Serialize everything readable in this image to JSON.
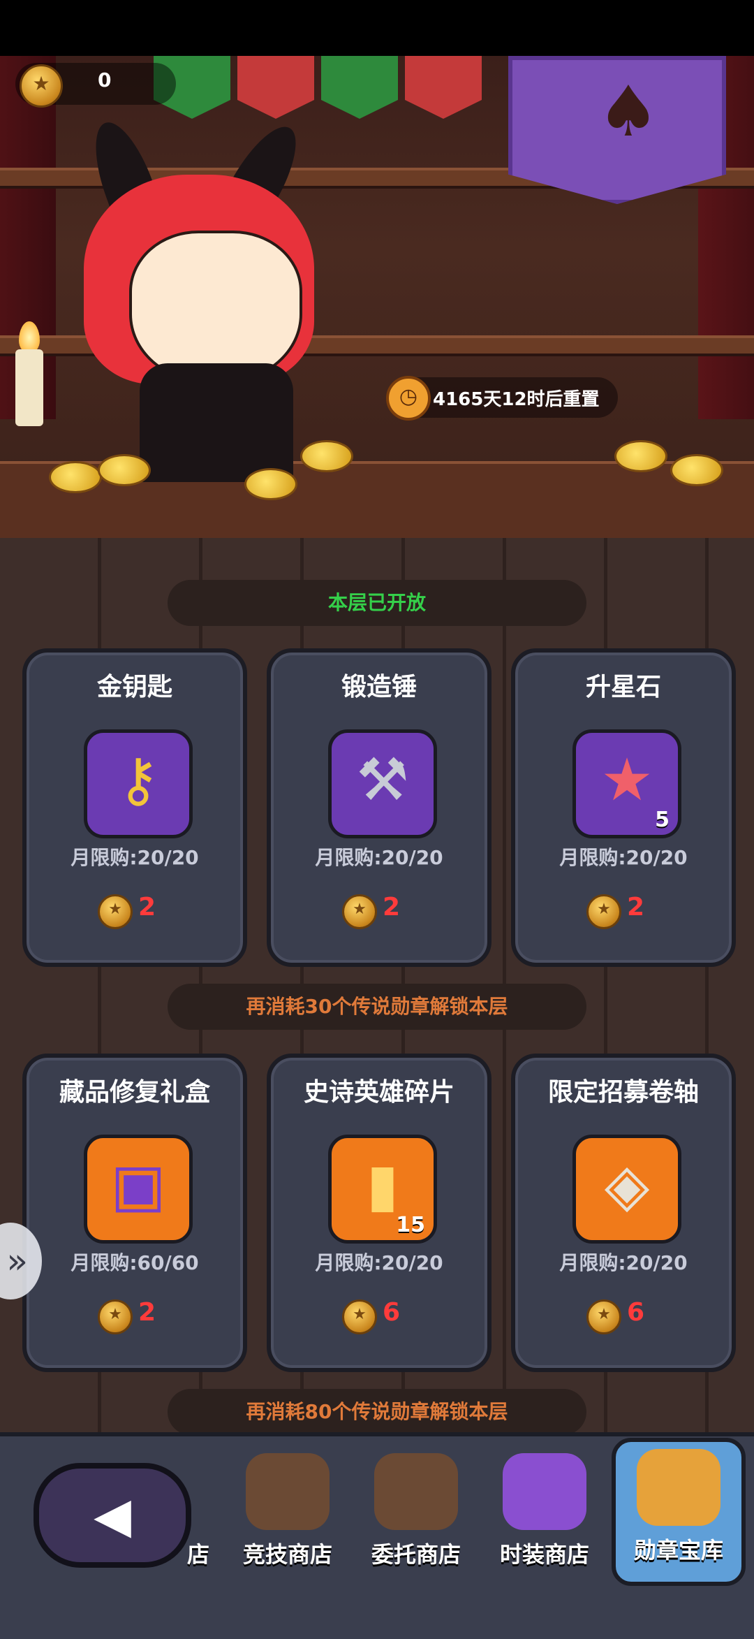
{
  "header": {
    "medal_count": "0",
    "reset_timer": "4165天12时后重置"
  },
  "sections": [
    {
      "status": "本层已开放",
      "status_color": "#35d04a",
      "items": [
        {
          "name": "金钥匙",
          "icon": "golden-key-icon",
          "bg": "purple",
          "glyph": "🔑",
          "qty": "",
          "limit": "月限购:20/20",
          "price": "2"
        },
        {
          "name": "锻造锤",
          "icon": "forge-hammer-icon",
          "bg": "purple",
          "glyph": "🔨",
          "qty": "",
          "limit": "月限购:20/20",
          "price": "2"
        },
        {
          "name": "升星石",
          "icon": "star-stone-icon",
          "bg": "purple",
          "glyph": "★",
          "qty": "5",
          "limit": "月限购:20/20",
          "price": "2"
        }
      ]
    },
    {
      "status": "再消耗30个传说勋章解锁本层",
      "status_color": "#e07a3a",
      "items": [
        {
          "name": "藏品修复礼盒",
          "icon": "treasure-chest-icon",
          "bg": "orange",
          "glyph": "🎁",
          "qty": "",
          "limit": "月限购:60/60",
          "price": "2"
        },
        {
          "name": "史诗英雄碎片",
          "icon": "hero-shard-card-icon",
          "bg": "orange",
          "glyph": "🂠",
          "qty": "15",
          "limit": "月限购:20/20",
          "price": "6"
        },
        {
          "name": "限定招募卷轴",
          "icon": "recruit-scroll-icon",
          "bg": "orange",
          "glyph": "📜",
          "qty": "",
          "limit": "月限购:20/20",
          "price": "6"
        }
      ]
    },
    {
      "status": "再消耗80个传说勋章解锁本层",
      "status_color": "#e07a3a"
    }
  ],
  "nav": {
    "partial_label": "店",
    "tabs": [
      {
        "label": "竞技商店",
        "icon": "arena-shop-bag-icon"
      },
      {
        "label": "委托商店",
        "icon": "commission-shop-bag-icon"
      },
      {
        "label": "时装商店",
        "icon": "fashion-shop-icon"
      },
      {
        "label": "勋章宝库",
        "icon": "medal-vault-icon"
      }
    ]
  }
}
